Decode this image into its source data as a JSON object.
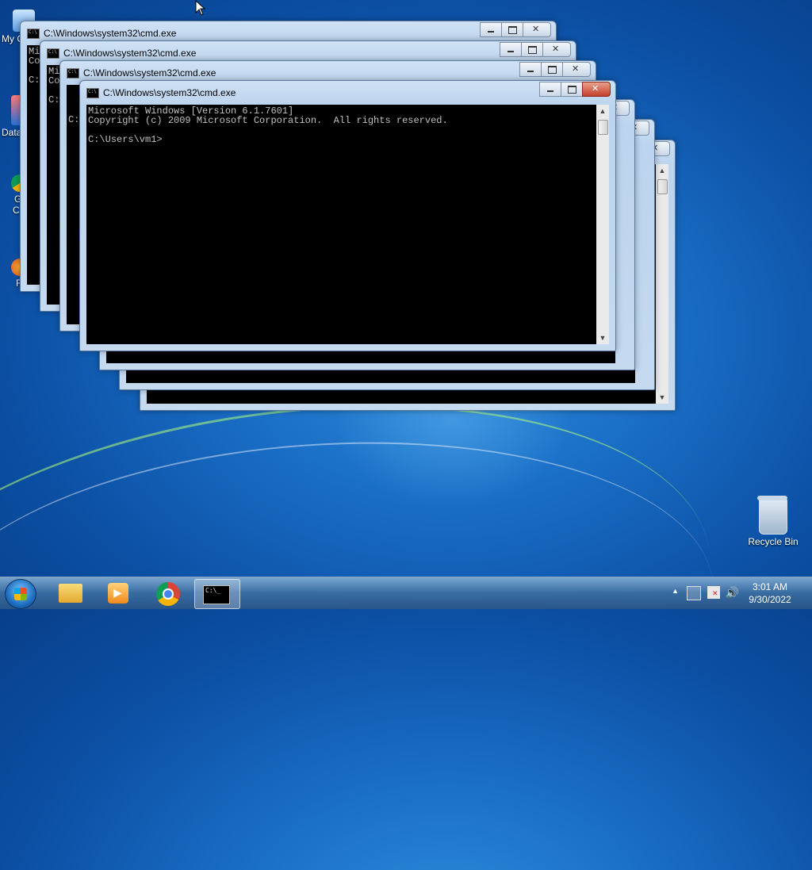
{
  "desktop": {
    "icons": [
      {
        "label": "My C"
      },
      {
        "label": "Data"
      },
      {
        "label": "G"
      },
      {
        "label": "C"
      },
      {
        "label": "Firefo"
      },
      {
        "label": "Recycle Bin"
      }
    ]
  },
  "windows": [
    {
      "title": "C:\\Windows\\system32\\cmd.exe",
      "lines": [
        "Mi",
        "Co",
        "",
        "C:"
      ]
    },
    {
      "title": "C:\\Windows\\system32\\cmd.exe",
      "lines": [
        "Mi",
        "Co",
        "",
        "C:"
      ]
    },
    {
      "title": "C:\\Windows\\system32\\cmd.exe",
      "lines": [
        "",
        "",
        "",
        "C:"
      ]
    },
    {
      "title": "C:\\Windows\\system32\\cmd.exe",
      "lines": [
        "Microsoft Windows [Version 6.1.7601]",
        "Copyright (c) 2009 Microsoft Corporation.  All rights reserved.",
        "",
        "C:\\Users\\vm1>"
      ]
    }
  ],
  "taskbar": {
    "items": [
      "start-orb",
      "windows-explorer",
      "media-player",
      "google-chrome",
      "command-prompt"
    ]
  },
  "tray": {
    "time": "3:01 AM",
    "date": "9/30/2022"
  },
  "icons": {
    "arrow_up": "▲",
    "speaker": "🔊",
    "scroll_up": "▲",
    "scroll_down": "▼"
  }
}
